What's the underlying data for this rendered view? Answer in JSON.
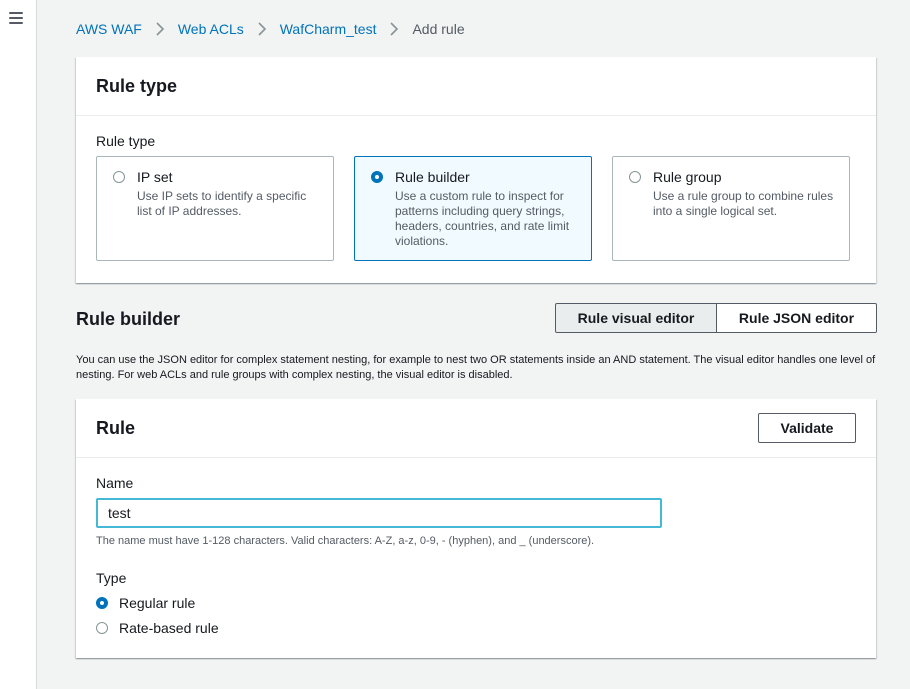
{
  "breadcrumb": {
    "items": [
      "AWS WAF",
      "Web ACLs",
      "WafCharm_test"
    ],
    "current": "Add rule"
  },
  "rule_type_panel": {
    "title": "Rule type",
    "field_label": "Rule type",
    "options": [
      {
        "title": "IP set",
        "desc": "Use IP sets to identify a specific list of IP addresses.",
        "selected": false
      },
      {
        "title": "Rule builder",
        "desc": "Use a custom rule to inspect for patterns including query strings, headers, countries, and rate limit violations.",
        "selected": true
      },
      {
        "title": "Rule group",
        "desc": "Use a rule group to combine rules into a single logical set.",
        "selected": false
      }
    ]
  },
  "rule_builder": {
    "heading": "Rule builder",
    "visual_editor_label": "Rule visual editor",
    "json_editor_label": "Rule JSON editor",
    "active_editor": "Rule visual editor",
    "info": "You can use the JSON editor for complex statement nesting, for example to nest two OR statements inside an AND statement. The visual editor handles one level of nesting. For web ACLs and rule groups with complex nesting, the visual editor is disabled."
  },
  "rule_panel": {
    "title": "Rule",
    "validate_label": "Validate",
    "name_label": "Name",
    "name_value": "test",
    "name_hint": "The name must have 1-128 characters. Valid characters: A-Z, a-z, 0-9, - (hyphen), and _ (underscore).",
    "type_label": "Type",
    "type_options": [
      "Regular rule",
      "Rate-based rule"
    ],
    "type_selected": "Regular rule"
  },
  "icons": {
    "menu": "hamburger-menu-icon",
    "separator": "chevron-right-icon"
  },
  "colors": {
    "link": "#0073bb",
    "selected_border": "#0073bb",
    "selected_bg": "#f1faff",
    "focus_border": "#44b9d6"
  }
}
